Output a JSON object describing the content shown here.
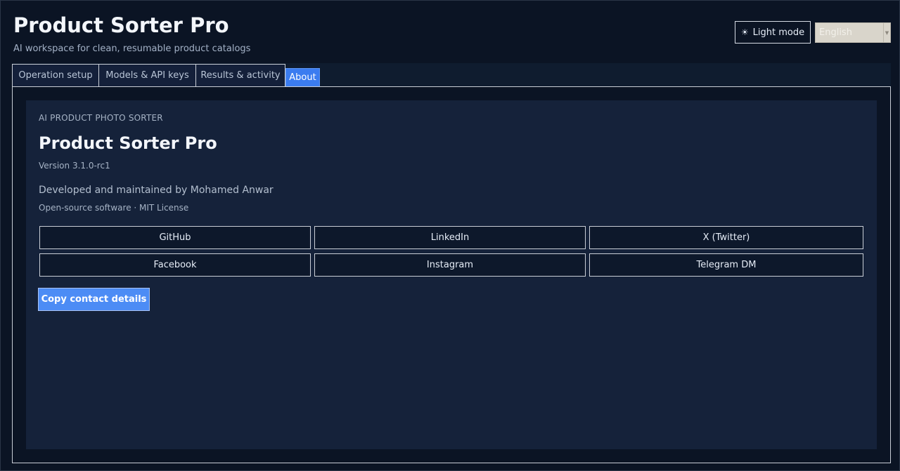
{
  "header": {
    "title": "Product Sorter Pro",
    "subtitle": "AI workspace for clean, resumable product catalogs",
    "theme_toggle": {
      "icon": "sun-icon",
      "glyph": "☀",
      "label": "Light mode"
    },
    "language_select": {
      "value": "English"
    }
  },
  "tabs": [
    {
      "label": "Operation setup",
      "active": false
    },
    {
      "label": "Models & API keys",
      "active": false
    },
    {
      "label": "Results & activity",
      "active": false
    },
    {
      "label": "About",
      "active": true
    }
  ],
  "about": {
    "eyebrow": "AI PRODUCT PHOTO SORTER",
    "title": "Product Sorter Pro",
    "version": "Version 3.1.0-rc1",
    "developer": "Developed and maintained by Mohamed Anwar",
    "license": "Open-source software · MIT License",
    "links": [
      {
        "label": "GitHub"
      },
      {
        "label": "LinkedIn"
      },
      {
        "label": "X (Twitter)"
      },
      {
        "label": "Facebook"
      },
      {
        "label": "Instagram"
      },
      {
        "label": "Telegram DM"
      }
    ],
    "copy_button": "Copy contact details"
  },
  "colors": {
    "background": "#0b1424",
    "card": "#15223a",
    "accent": "#3b7cf0",
    "copy_button": "#4c8cf5"
  }
}
